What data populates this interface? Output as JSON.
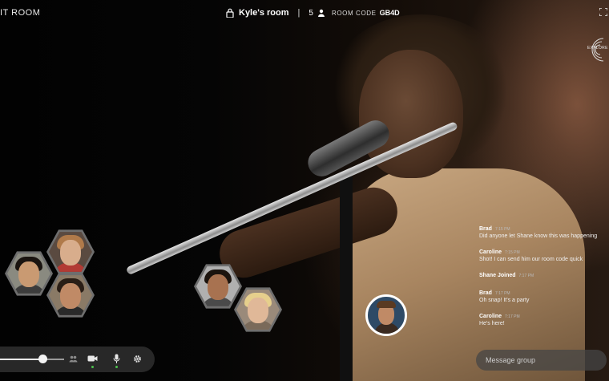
{
  "top": {
    "exit_label": "IT ROOM",
    "room_name": "Kyle's room",
    "divider": "|",
    "participant_count": "5",
    "room_code_label": "ROOM CODE",
    "room_code": "GB4D",
    "brand_text": "EXPLORE"
  },
  "participants": [
    {
      "label": "participant-woman-red",
      "skin": "#d8ad8c",
      "hair": "#b07a4a",
      "shirt": "#b23a34",
      "bg": "#5a4a40"
    },
    {
      "label": "participant-man-asian",
      "skin": "#c99a72",
      "hair": "#1a1410",
      "shirt": "#3c3c3c",
      "bg": "#8a8a80"
    },
    {
      "label": "participant-man-glasses",
      "skin": "#c08a66",
      "hair": "#2a1e16",
      "shirt": "#2a2a2a",
      "bg": "#8a7a66"
    },
    {
      "label": "participant-man-beard",
      "skin": "#a87250",
      "hair": "#1c140e",
      "shirt": "#4a4a4a",
      "bg": "#b0b0b0"
    },
    {
      "label": "participant-woman-blonde",
      "skin": "#e0b898",
      "hair": "#e6cf8c",
      "shirt": "#7a6a5a",
      "bg": "#9a8a7a"
    }
  ],
  "chat": {
    "messages": [
      {
        "name": "Brad",
        "time": "7:15 PM",
        "text": "Did anyone let Shane know this was happening"
      },
      {
        "name": "Caroline",
        "time": "7:15 PM",
        "text": "Shot! I can send him our room code quick"
      },
      {
        "system": "Shane Joined",
        "time": "7:17 PM"
      },
      {
        "name": "Brad",
        "time": "7:17 PM",
        "text": "Oh snap! It's a party"
      },
      {
        "name": "Caroline",
        "time": "7:17 PM",
        "text": "He's here!"
      }
    ],
    "input_placeholder": "Message group"
  },
  "controls": {
    "volume": 0.67,
    "icons": [
      "people-icon",
      "camera-icon",
      "microphone-icon",
      "settings-icon"
    ],
    "active_color": "#4cc24c"
  }
}
